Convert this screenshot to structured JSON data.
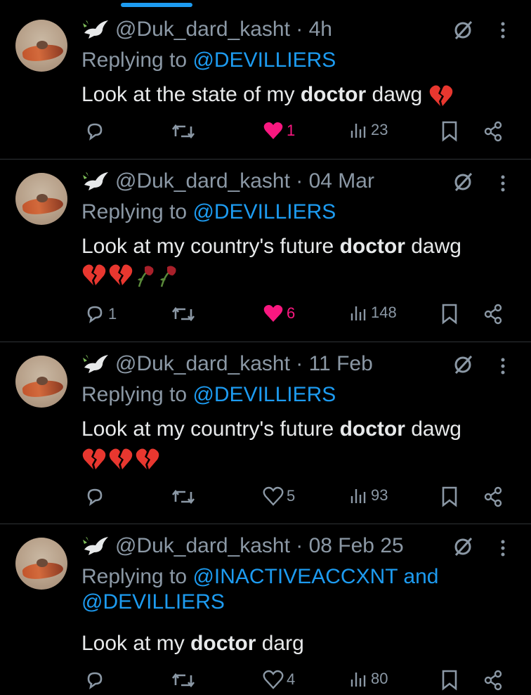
{
  "tweets": [
    {
      "handle": "@Duk_dard_kasht",
      "time": "· 4h",
      "replying_prefix": "Replying to ",
      "replying_to": "@DEVILLIERS",
      "text_before": "Look at the state of my ",
      "text_bold": "doctor",
      "text_after": " dawg",
      "emojis": [
        "broken-heart"
      ],
      "replies": "",
      "likes": "1",
      "liked": true,
      "views": "23"
    },
    {
      "handle": "@Duk_dard_kasht",
      "time": "· 04 Mar",
      "replying_prefix": "Replying to ",
      "replying_to": "@DEVILLIERS",
      "text_before": "Look at my country's future ",
      "text_bold": "doctor",
      "text_after": " dawg",
      "emojis": [
        "broken-heart",
        "broken-heart",
        "wilted-rose",
        "wilted-rose"
      ],
      "replies": "1",
      "likes": "6",
      "liked": true,
      "views": "148"
    },
    {
      "handle": "@Duk_dard_kasht",
      "time": "· 11 Feb",
      "replying_prefix": "Replying to ",
      "replying_to": "@DEVILLIERS",
      "text_before": "Look at my country's future ",
      "text_bold": "doctor",
      "text_after": " dawg",
      "emojis": [
        "broken-heart",
        "broken-heart",
        "broken-heart"
      ],
      "replies": "",
      "likes": "5",
      "liked": false,
      "views": "93"
    },
    {
      "handle": "@Duk_dard_kasht",
      "time": "· 08 Feb 25",
      "replying_prefix": "Replying to ",
      "replying_to": "@INACTIVEACCXNT and",
      "replying_to_2": "@DEVILLIERS",
      "text_before": "Look at my ",
      "text_bold": "doctor",
      "text_after": " darg",
      "emojis": [],
      "replies": "",
      "likes": "4",
      "liked": false,
      "views": "80"
    }
  ],
  "colors": {
    "accent": "#1d9bf0",
    "like": "#f91880",
    "muted": "#8b98a5",
    "text": "#e7e9ea",
    "divider": "#2f3336"
  }
}
